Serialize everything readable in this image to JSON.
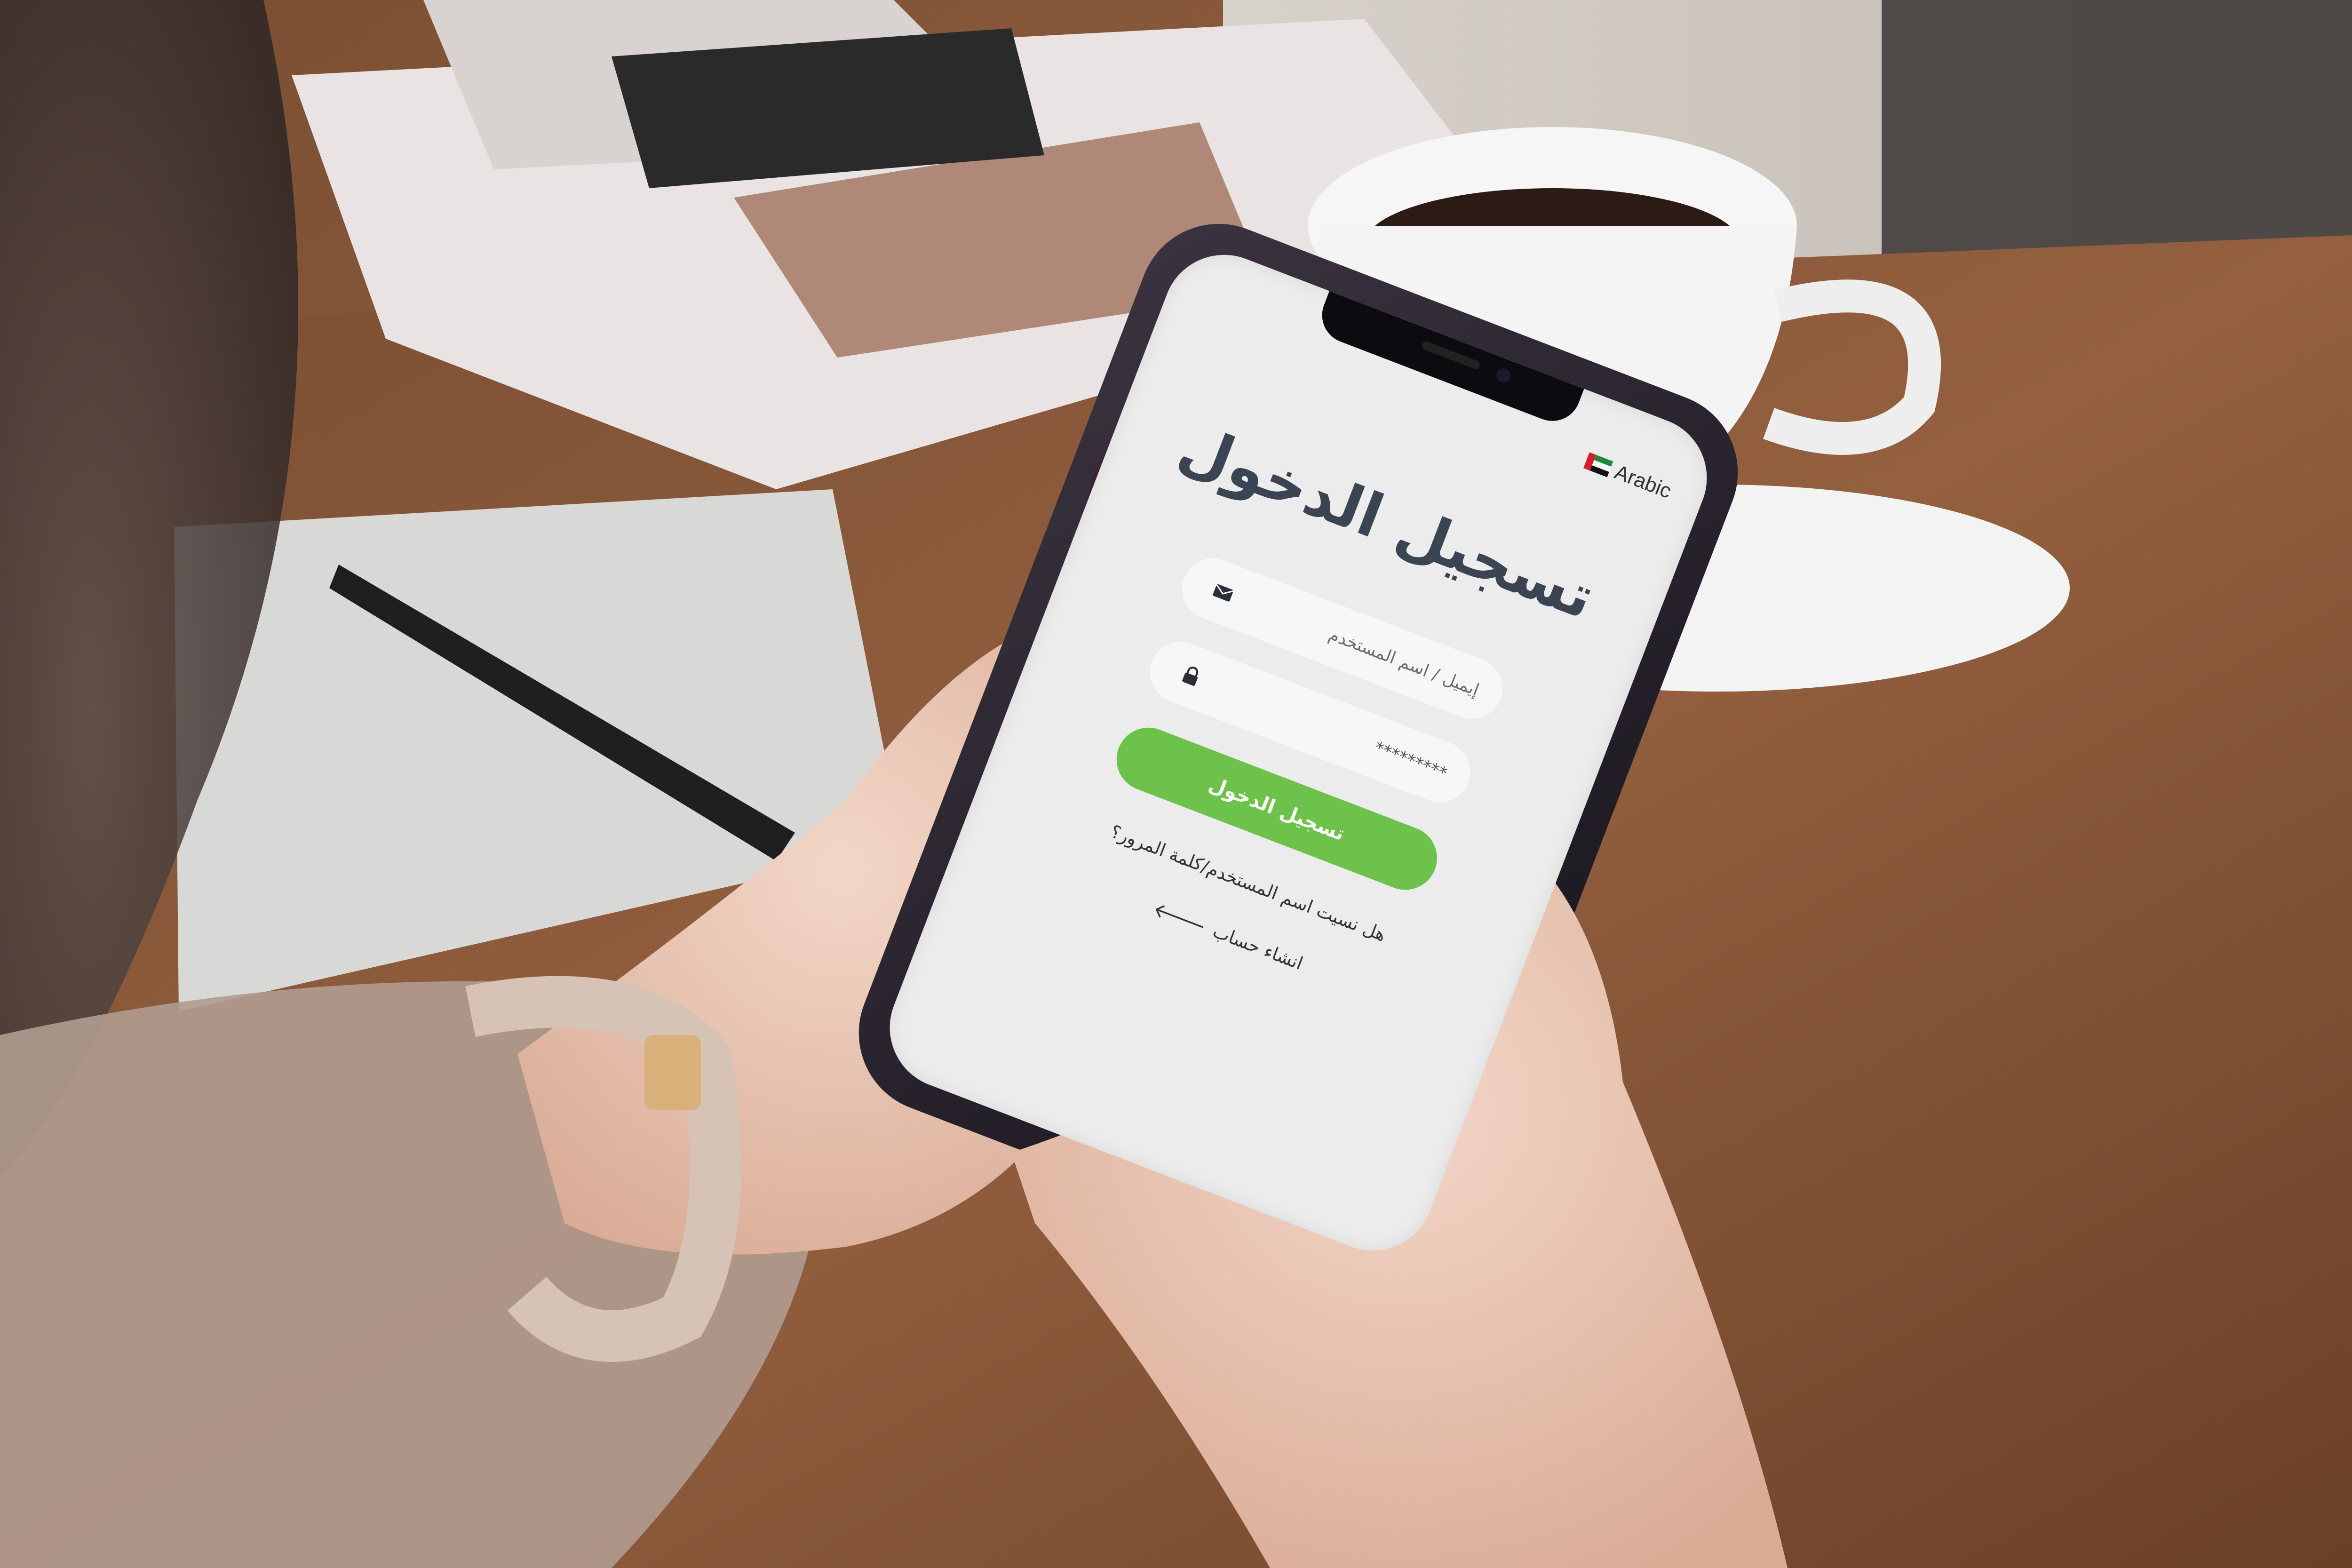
{
  "screen": {
    "language_label": "Arabic",
    "language_flag": "uae-flag",
    "title": "تسجيل الدخول",
    "email_placeholder": "إيميل / اسم المستخدم",
    "password_value": "*********",
    "login_button_label": "تسجيل الدخول",
    "forgot_link": "هل نسيت اسم المستخدم/كلمة المرور؟",
    "register_link": "انشاء حساب",
    "register_arrow": "🡐"
  },
  "colors": {
    "button_green": "#6cc24a",
    "title": "#3a4452",
    "screen_background": "#ececec",
    "field_background": "#f7f7f7",
    "table_wood": "#8a5a3c",
    "phone_frame": "#1d1a22"
  },
  "icons": {
    "email": "envelope-icon",
    "password": "lock-icon",
    "register": "arrow-left-icon"
  }
}
